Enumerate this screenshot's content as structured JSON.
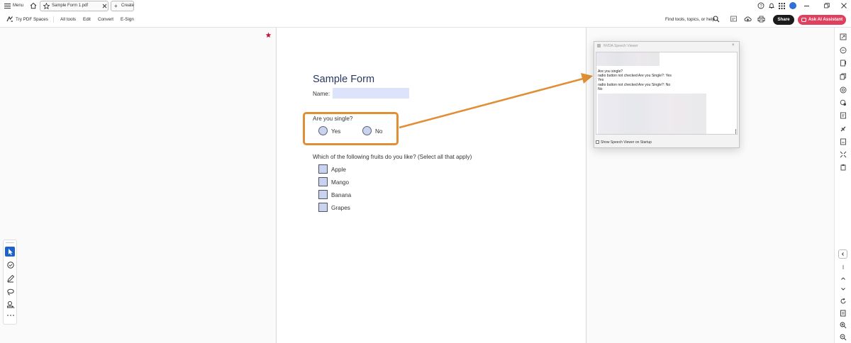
{
  "titlebar": {
    "menu_label": "Menu",
    "tab_title": "Sample Form 1.pdf",
    "create_label": "Create"
  },
  "toolbar": {
    "try_pdf_spaces": "Try PDF Spaces",
    "all_tools": "All tools",
    "edit": "Edit",
    "convert": "Convert",
    "esign": "E-Sign",
    "find_placeholder": "Find tools, topics, or help",
    "share": "Share",
    "ask_ai": "Ask AI Assistant"
  },
  "form": {
    "title": "Sample Form",
    "name_label": "Name:",
    "name_value": "",
    "single_question": "Are you single?",
    "radio_options": [
      "Yes",
      "No"
    ],
    "fruits_question": "Which of the following fruits do you like? (Select all that apply)",
    "fruits": [
      "Apple",
      "Mango",
      "Banana",
      "Grapes"
    ]
  },
  "nvda": {
    "title": "NVDA Speech Viewer",
    "lines": [
      "Are you single?",
      "radio button  not checked   Are you Single?: Yes",
      "Yes",
      "radio button  not checked   Are you Single?: No",
      "No"
    ],
    "startup_label": "Show Speech Viewer on Startup"
  },
  "colors": {
    "accent_orange": "#df8f35",
    "field_blue": "#dce3fb",
    "ai_pink": "#e0405e",
    "share_black": "#1b1b1b"
  },
  "icons": {
    "home": "home-icon",
    "star": "star-icon",
    "search": "search-icon",
    "bell": "bell-icon",
    "help": "help-icon",
    "apps": "apps-grid-icon"
  }
}
